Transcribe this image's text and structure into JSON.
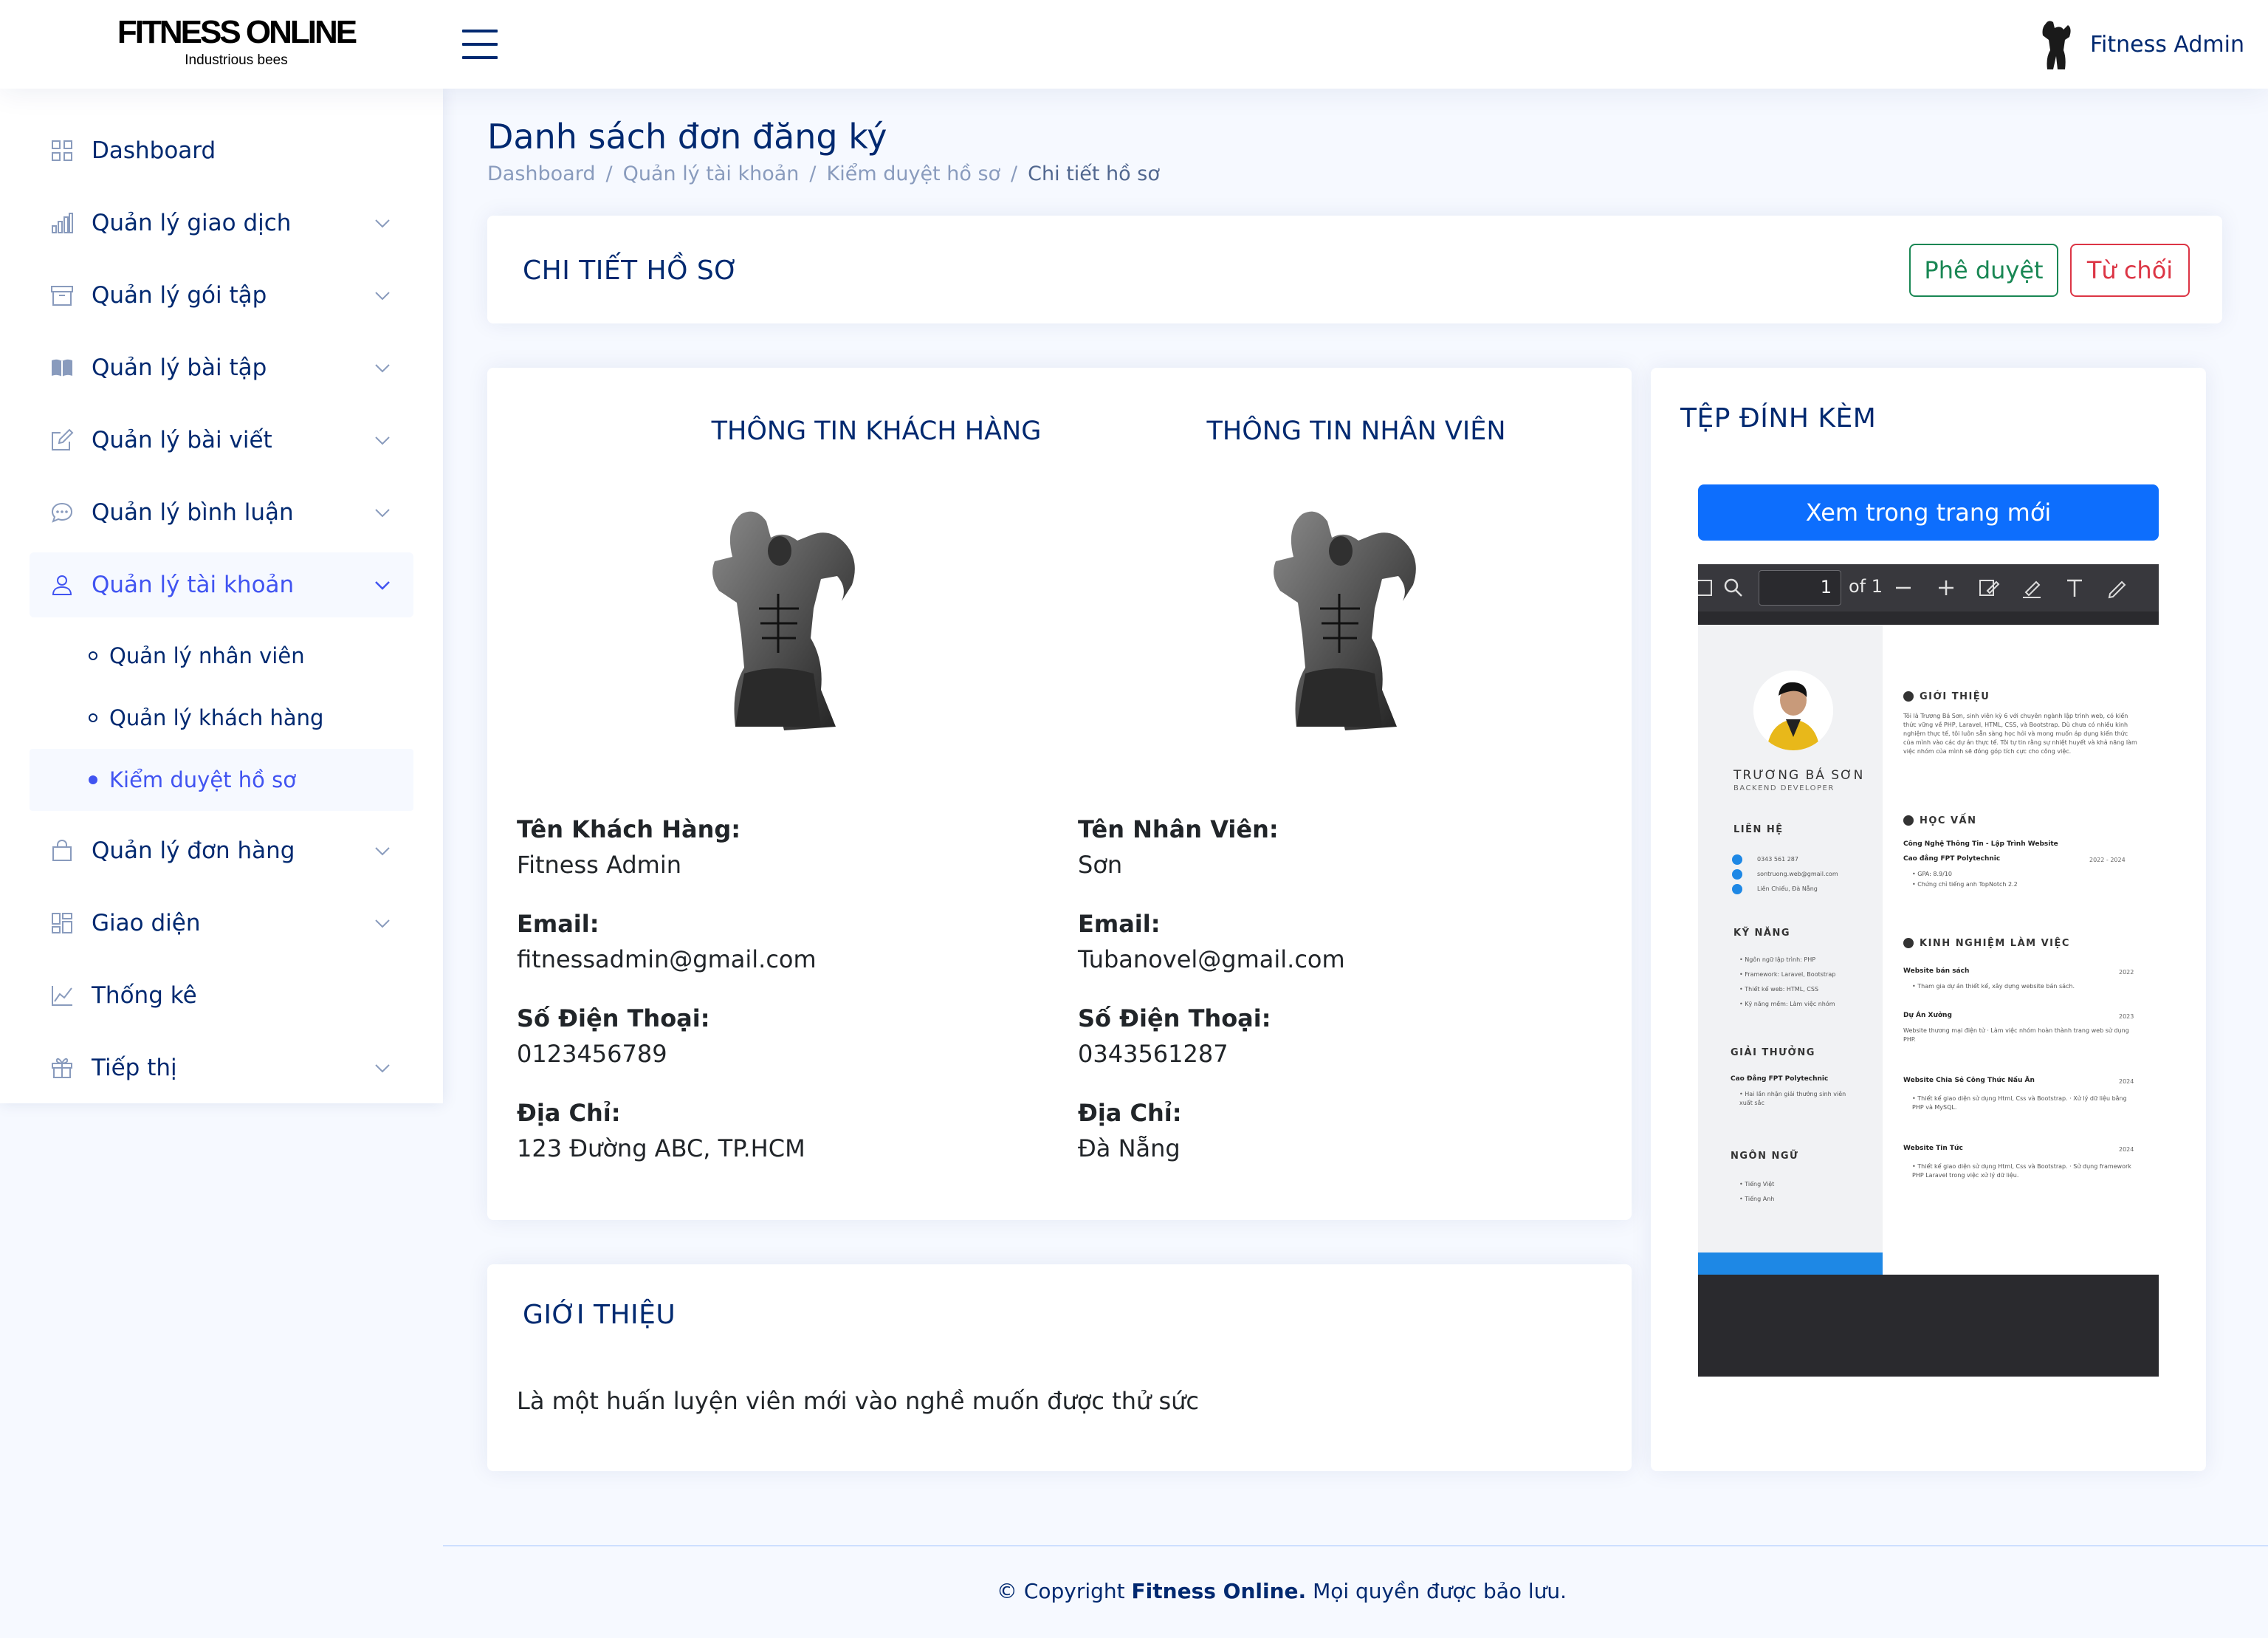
{
  "header": {
    "logo_title": "FITNESS ONLINE",
    "logo_subtitle": "Industrious bees",
    "user_name": "Fitness Admin"
  },
  "sidebar": {
    "items": [
      {
        "label": "Dashboard",
        "icon": "grid-icon"
      },
      {
        "label": "Quản lý giao dịch",
        "icon": "bar-chart-icon"
      },
      {
        "label": "Quản lý gói tập",
        "icon": "archive-icon"
      },
      {
        "label": "Quản lý bài tập",
        "icon": "book-icon"
      },
      {
        "label": "Quản lý bài viết",
        "icon": "pencil-square-icon"
      },
      {
        "label": "Quản lý bình luận",
        "icon": "chat-icon"
      },
      {
        "label": "Quản lý tài khoản",
        "icon": "person-icon"
      },
      {
        "label": "Quản lý đơn hàng",
        "icon": "bag-icon"
      },
      {
        "label": "Giao diện",
        "icon": "layout-icon"
      },
      {
        "label": "Thống kê",
        "icon": "graph-icon"
      },
      {
        "label": "Tiếp thị",
        "icon": "gift-icon"
      }
    ],
    "account_sub": [
      {
        "label": "Quản lý nhân viên"
      },
      {
        "label": "Quản lý khách hàng"
      },
      {
        "label": "Kiểm duyệt hồ sơ"
      }
    ]
  },
  "page": {
    "title": "Danh sách đơn đăng ký",
    "breadcrumb": [
      "Dashboard",
      "Quản lý tài khoản",
      "Kiểm duyệt hồ sơ",
      "Chi tiết hồ sơ"
    ],
    "breadcrumb_sep": "/"
  },
  "detail_card": {
    "title": "CHI TIẾT HỒ SƠ",
    "approve_label": "Phê duyệt",
    "reject_label": "Từ chối"
  },
  "customer": {
    "heading": "THÔNG TIN KHÁCH HÀNG",
    "name_label": "Tên Khách Hàng:",
    "name": "Fitness Admin",
    "email_label": "Email:",
    "email": "fitnessadmin@gmail.com",
    "phone_label": "Số Điện Thoại:",
    "phone": "0123456789",
    "address_label": "Địa Chỉ:",
    "address": "123 Đường ABC, TP.HCM"
  },
  "employee": {
    "heading": "THÔNG TIN NHÂN VIÊN",
    "name_label": "Tên Nhân Viên:",
    "name": "Sơn",
    "email_label": "Email:",
    "email": "Tubanovel@gmail.com",
    "phone_label": "Số Điện Thoại:",
    "phone": "0343561287",
    "address_label": "Địa Chỉ:",
    "address": "Đà Nẵng"
  },
  "attachment": {
    "title": "TỆP ĐÍNH KÈM",
    "open_label": "Xem trong trang mới",
    "pdf": {
      "page_value": "1",
      "of_label": "of 1"
    },
    "cv": {
      "name": "TRƯƠNG BÁ SƠN",
      "role": "BACKEND DEVELOPER",
      "contact_h": "LIÊN HỆ",
      "phone": "0343 561 287",
      "email": "sontruong.web@gmail.com",
      "location": "Liên Chiểu, Đà Nẵng",
      "skills_h": "KỸ NĂNG",
      "skills": [
        "Ngôn ngữ lập trình: PHP",
        "Framework: Laravel, Bootstrap",
        "Thiết kế web: HTML, CSS",
        "Kỹ năng mềm: Làm việc nhóm"
      ],
      "awards_h": "GIẢI THƯỞNG",
      "award_title": "Cao Đẳng FPT Polytechnic",
      "award_desc": "Hai lần nhận giải thưởng sinh viên xuất sắc",
      "lang_h": "NGÔN NGỮ",
      "langs": [
        "Tiếng Việt",
        "Tiếng Anh"
      ],
      "intro_h": "GIỚI THIỆU",
      "intro": "Tôi là Trương Bá Sơn, sinh viên kỳ 6 với chuyên ngành lập trình web, có kiến thức vững về PHP, Laravel, HTML, CSS, và Bootstrap. Dù chưa có nhiều kinh nghiệm thực tế, tôi luôn sẵn sàng học hỏi và mong muốn áp dụng kiến thức của mình vào các dự án thực tế. Tôi tự tin rằng sự nhiệt huyết và khả năng làm việc nhóm của mình sẽ đóng góp tích cực cho công việc.",
      "edu_h": "HỌC VẤN",
      "edu_title": "Công Nghệ Thông Tin - Lập Trình Website",
      "edu_school": "Cao đẳng FPT Polytechnic",
      "edu_date": "2022 - 2024",
      "edu_items": [
        "GPA: 8.9/10",
        "Chứng chỉ tiếng anh TopNotch 2.2"
      ],
      "exp_h": "KINH NGHIỆM LÀM VIỆC",
      "exp": [
        {
          "title": "Website bán sách",
          "date": "2022",
          "desc": "Tham gia dự án thiết kế, xây dựng website bán sách."
        },
        {
          "title": "Dự Án Xưởng",
          "date": "2023",
          "desc": "Website thương mại điện tử · Làm việc nhóm hoàn thành trang web sử dụng PHP."
        },
        {
          "title": "Website Chia Sẻ Công Thức Nấu Ăn",
          "date": "2024",
          "desc": "Thiết kế giao diện sử dụng Html, Css và Bootstrap. · Xử lý dữ liệu bằng PHP và MySQL."
        },
        {
          "title": "Website Tin Tức",
          "date": "2024",
          "desc": "Thiết kế giao diện sử dụng Html, Css và Bootstrap. · Sử dụng framework PHP Laravel trong việc xử lý dữ liệu."
        }
      ]
    }
  },
  "intro_card": {
    "title": "GIỚI THIỆU",
    "text": "Là một huấn luyện viên mới vào nghề muốn được thử sức"
  },
  "footer": {
    "prefix": "© Copyright",
    "brand": "Fitness Online.",
    "suffix": "Mọi quyền được bảo lưu."
  }
}
